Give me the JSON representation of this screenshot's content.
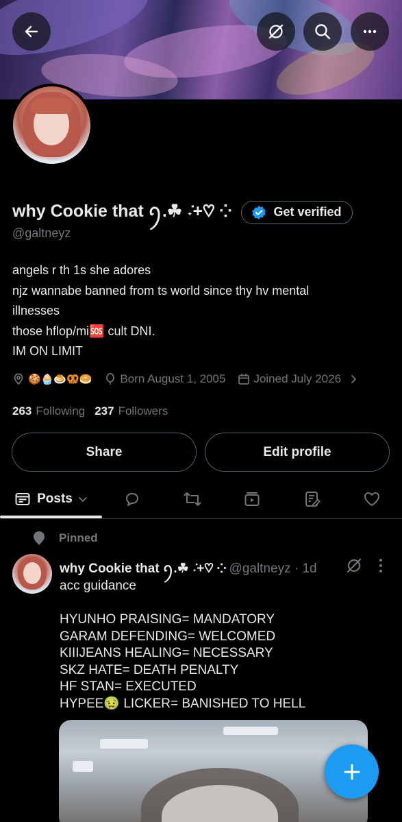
{
  "header": {
    "back_icon": "arrow-left-icon",
    "grok_icon": "grok-icon",
    "search_icon": "search-icon",
    "more_icon": "more-horizontal-icon"
  },
  "profile": {
    "display_name": "why Cookie that ꪆ.☘︎ ݁˖+♡︎ ⁘",
    "verify_label": "Get verified",
    "handle": "@galtneyz",
    "bio_lines": [
      "angels r th 1s she adores",
      "njz wannabe banned from ts world since thy hv mental illnesses",
      "those hflop/mi🆘 cult DNI.",
      "IM ON LIMIT"
    ],
    "location": "🍪🧁🍮🥨🥯",
    "birthday": "Born August 1, 2005",
    "joined": "Joined July 2026",
    "following_count": "263",
    "following_label": "Following",
    "followers_count": "237",
    "followers_label": "Followers",
    "share_label": "Share",
    "edit_label": "Edit profile"
  },
  "tabs": {
    "posts_label": "Posts",
    "icons": [
      "reply-icon",
      "repost-icon",
      "media-icon",
      "articles-icon",
      "like-icon"
    ]
  },
  "post": {
    "pinned_label": "Pinned",
    "author_name": "why Cookie that ꪆ.☘︎ ݁˖+♡︎ ⁘",
    "author_handle": "@galtneyz · 1d",
    "text": "acc guidance\n\nHYUNHO PRAISING= MANDATORY\nGARAM DEFENDING= WELCOMED\nKIIIJEANS HEALING= NECESSARY\nSKZ HATE= DEATH PENALTY\nHF STAN= EXECUTED\nHYPEE🤢 LICKER= BANISHED TO HELL"
  },
  "colors": {
    "accent": "#1d9bf0",
    "muted": "#71767b",
    "border": "#536471",
    "text": "#e7e9ea"
  }
}
